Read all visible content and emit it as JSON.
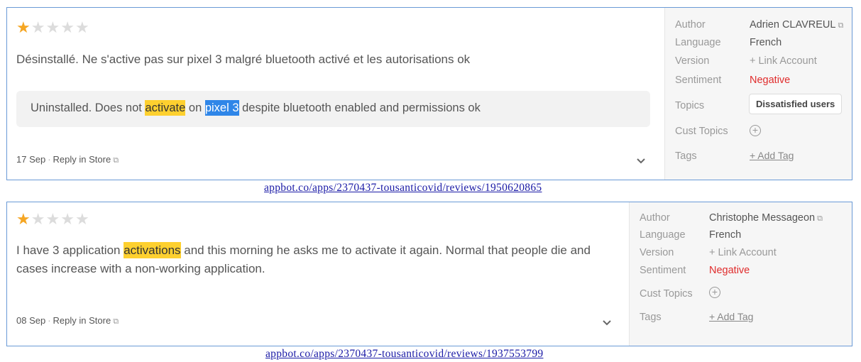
{
  "reviews": [
    {
      "rating": 1,
      "max_rating": 5,
      "text": "Désinstallé. Ne s'active pas sur pixel 3 malgré bluetooth activé et les autorisations ok",
      "translation": {
        "before": "Uninstalled. Does not ",
        "hl1": "activate",
        "mid": " on ",
        "hl2": "pixel 3",
        "after": " despite bluetooth enabled and permissions ok"
      },
      "date": "17 Sep",
      "reply_label": "Reply in Store",
      "meta": {
        "author_label": "Author",
        "author": "Adrien CLAVREUL",
        "language_label": "Language",
        "language": "French",
        "version_label": "Version",
        "version": "+ Link Account",
        "sentiment_label": "Sentiment",
        "sentiment": "Negative",
        "topics_label": "Topics",
        "topic": "Dissatisfied users",
        "cust_topics_label": "Cust Topics",
        "tags_label": "Tags",
        "add_tag": "+ Add Tag"
      },
      "url": "appbot.co/apps/2370437-tousanticovid/reviews/1950620865"
    },
    {
      "rating": 1,
      "max_rating": 5,
      "text": {
        "before": "I have 3 application ",
        "hl1": "activations",
        "after_line1": " and this morning he asks me to activate it again. Normal that people die and",
        "line2": "cases increase with a non-working application."
      },
      "date": "08 Sep",
      "reply_label": "Reply in Store",
      "meta": {
        "author_label": "Author",
        "author": "Christophe Messageon",
        "language_label": "Language",
        "language": "French",
        "version_label": "Version",
        "version": "+ Link Account",
        "sentiment_label": "Sentiment",
        "sentiment": "Negative",
        "cust_topics_label": "Cust Topics",
        "tags_label": "Tags",
        "add_tag": "+ Add Tag"
      },
      "url": "appbot.co/apps/2370437-tousanticovid/reviews/1937553799"
    }
  ],
  "colors": {
    "star_on": "#f5a623",
    "star_off": "#dcdcdc",
    "negative": "#e02c2c",
    "highlight_yellow": "#fed02f",
    "highlight_blue": "#2f86e8",
    "border": "#6a9ad6"
  },
  "icons": [
    "star-icon",
    "external-link-icon",
    "chevron-down-icon",
    "plus-circle-icon"
  ]
}
